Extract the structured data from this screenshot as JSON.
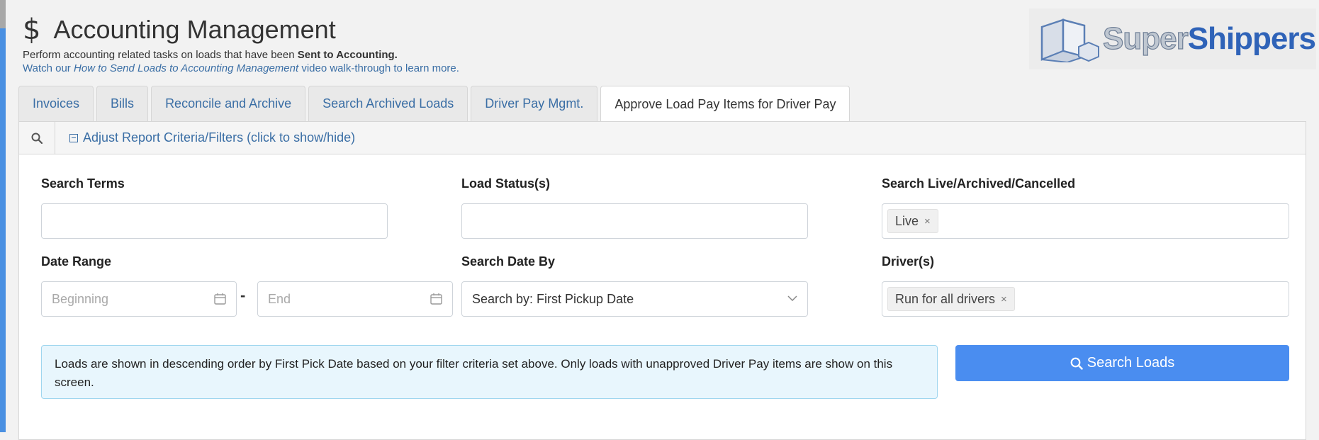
{
  "header": {
    "icon": "dollar-icon",
    "title": "Accounting Management",
    "subtitle_prefix": "Perform accounting related tasks on loads that have been",
    "subtitle_bold": "Sent to Accounting.",
    "watch_prefix": "Watch our",
    "watch_link": "How to Send Loads to Accounting Management",
    "watch_suffix": "video walk-through to learn more."
  },
  "logo": {
    "super": "Super",
    "shippers": "Shippers"
  },
  "tabs": [
    {
      "label": "Invoices",
      "active": false
    },
    {
      "label": "Bills",
      "active": false
    },
    {
      "label": "Reconcile and Archive",
      "active": false
    },
    {
      "label": "Search Archived Loads",
      "active": false
    },
    {
      "label": "Driver Pay Mgmt.",
      "active": false
    },
    {
      "label": "Approve Load Pay Items for Driver Pay",
      "active": true
    }
  ],
  "filter_toggle": "Adjust Report Criteria/Filters (click to show/hide)",
  "form": {
    "search_terms": {
      "label": "Search Terms",
      "value": ""
    },
    "load_status": {
      "label": "Load Status(s)",
      "value": ""
    },
    "live_archived": {
      "label": "Search Live/Archived/Cancelled",
      "tag": "Live"
    },
    "date_range": {
      "label": "Date Range",
      "begin_placeholder": "Beginning",
      "end_placeholder": "End",
      "separator": "-"
    },
    "search_date_by": {
      "label": "Search Date By",
      "value": "Search by: First Pickup Date"
    },
    "drivers": {
      "label": "Driver(s)",
      "tag": "Run for all drivers"
    }
  },
  "tag_remove": "×",
  "info_text": "Loads are shown in descending order by First Pick Date based on your filter criteria set above. Only loads with unapproved Driver Pay items are show on this screen.",
  "search_button": "Search Loads",
  "colors": {
    "accent": "#4a8df0",
    "link": "#3a6ea5",
    "info_bg": "#e8f6fd"
  }
}
